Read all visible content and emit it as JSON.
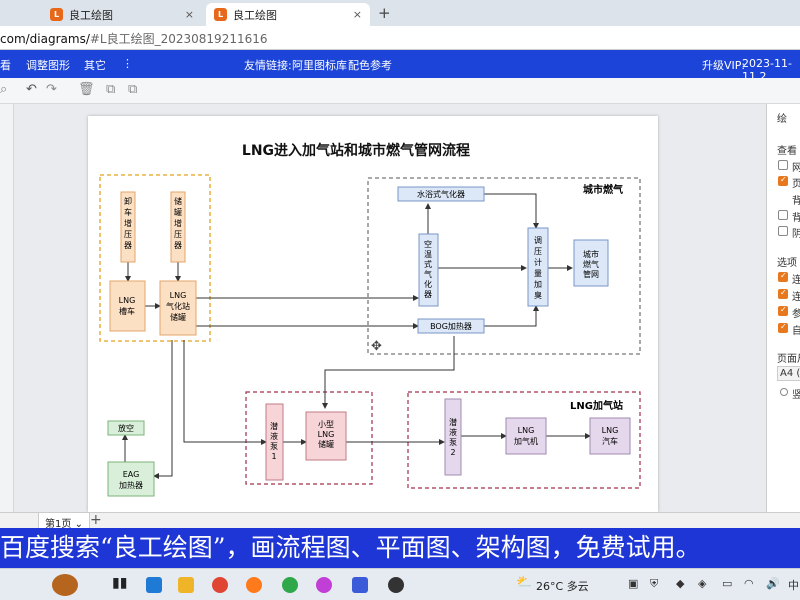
{
  "browser": {
    "tabs": [
      {
        "title": "良工绘图",
        "close": "×",
        "active": false
      },
      {
        "title": "良工绘图",
        "close": "×",
        "active": true
      }
    ],
    "new_tab": "+",
    "url_host": "com/diagrams/",
    "url_path": "#L良工绘图_20230819211616"
  },
  "app_header": {
    "menu": [
      "看",
      "调整图形",
      "其它",
      "⋮"
    ],
    "links_label": "友情链接:",
    "links": [
      "阿里图标库",
      "配色参考"
    ],
    "vip": "升级VIP:",
    "date": "2023-11-11 2"
  },
  "toolbar": {
    "icons": [
      "search-icon",
      "undo-icon",
      "redo-icon",
      "delete-icon",
      "copy-icon",
      "paste-icon"
    ]
  },
  "diagram": {
    "title": "LNG进入加气站和城市燃气管网流程",
    "sections": {
      "city_gas": "城市燃气",
      "lng_station": "LNG加气站"
    },
    "nodes": {
      "unload_pressurizer": [
        "卸",
        "车",
        "增",
        "压",
        "器"
      ],
      "tank_pressurizer": [
        "储",
        "罐",
        "增",
        "压",
        "器"
      ],
      "lng_truck": [
        "LNG",
        "槽车"
      ],
      "station_tank": [
        "LNG",
        "气化站",
        "储罐"
      ],
      "water_bath_vaporizer": "水浴式气化器",
      "air_vaporizer": [
        "空",
        "温",
        "式",
        "气",
        "化",
        "器"
      ],
      "regulator": [
        "调",
        "压",
        "计",
        "量",
        "加",
        "臭"
      ],
      "city_pipe": [
        "城市",
        "燃气",
        "管网"
      ],
      "bog_heater": "BOG加热器",
      "vent": "放空",
      "eag_heater": [
        "EAG",
        "加热器"
      ],
      "pump1": [
        "潜",
        "液",
        "泵",
        "1"
      ],
      "small_tank": [
        "小型",
        "LNG",
        "储罐"
      ],
      "pump2": [
        "潜",
        "液",
        "泵",
        "2"
      ],
      "dispenser": [
        "LNG",
        "加气机"
      ],
      "vehicle": [
        "LNG",
        "汽车"
      ]
    }
  },
  "right_panel": {
    "labels": [
      "绘",
      "查看",
      "网",
      "页",
      "背",
      "背",
      "阴",
      "选项",
      "连",
      "连",
      "参",
      "自",
      "页面尺",
      "A4 (2",
      "竖"
    ],
    "checkbox_states": [
      false,
      true,
      false,
      false,
      true,
      true,
      true,
      true
    ]
  },
  "page_tabs": {
    "current": "第1页",
    "caret": "⌄",
    "add": "+"
  },
  "subtitle": "百度搜索“良工绘图”，画流程图、平面图、架构图，免费试用。",
  "taskbar": {
    "weather_temp": "26°C",
    "weather_text": "多云",
    "accent": "#1f36d6"
  }
}
